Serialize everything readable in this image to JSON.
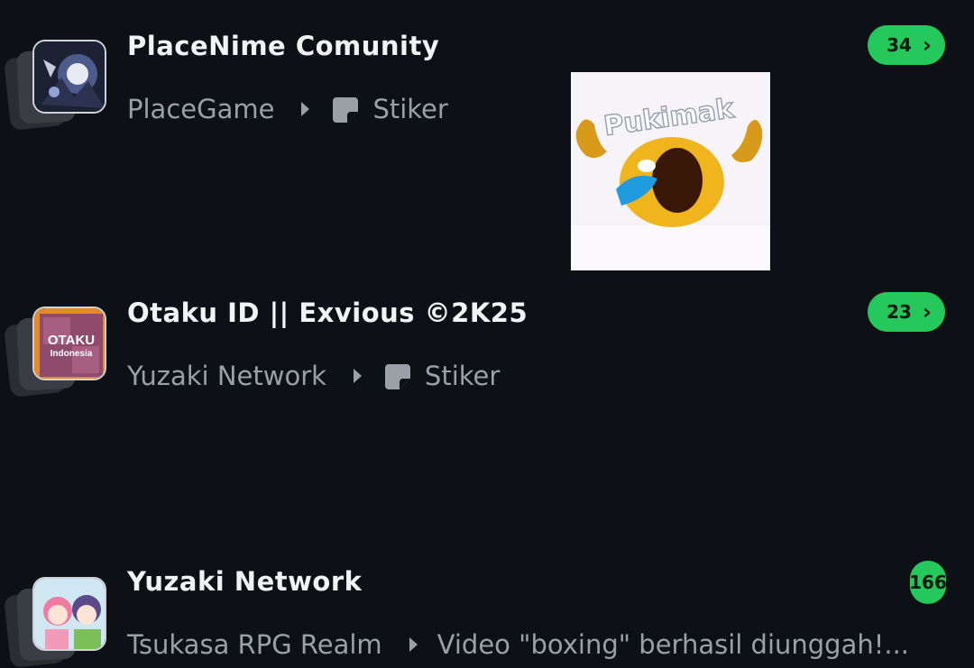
{
  "chats": [
    {
      "title": "PlaceNime Comunity",
      "community": "PlaceGame",
      "message": "Stiker",
      "message_icon": "sticker-icon",
      "unread": "34",
      "badge_chevron": "›"
    },
    {
      "title": "Otaku ID || Exvious ©2K25",
      "community": "Yuzaki Network",
      "message": "Stiker",
      "message_icon": "sticker-icon",
      "unread": "23",
      "badge_chevron": "›"
    },
    {
      "title": "Yuzaki Network",
      "community": "Tsukasa RPG Realm",
      "message": "Video \"boxing\" berhasil diunggah!...",
      "unread": "166"
    }
  ],
  "avatar_text": {
    "otaku_line1": "OTAKU",
    "otaku_line2": "Indonesia"
  },
  "sticker_popup": {
    "text": "Pukimak"
  },
  "colors": {
    "background": "#0d1015",
    "badge": "#25c85a",
    "title": "#f2f3f5",
    "subtitle": "#9ba0a6"
  }
}
